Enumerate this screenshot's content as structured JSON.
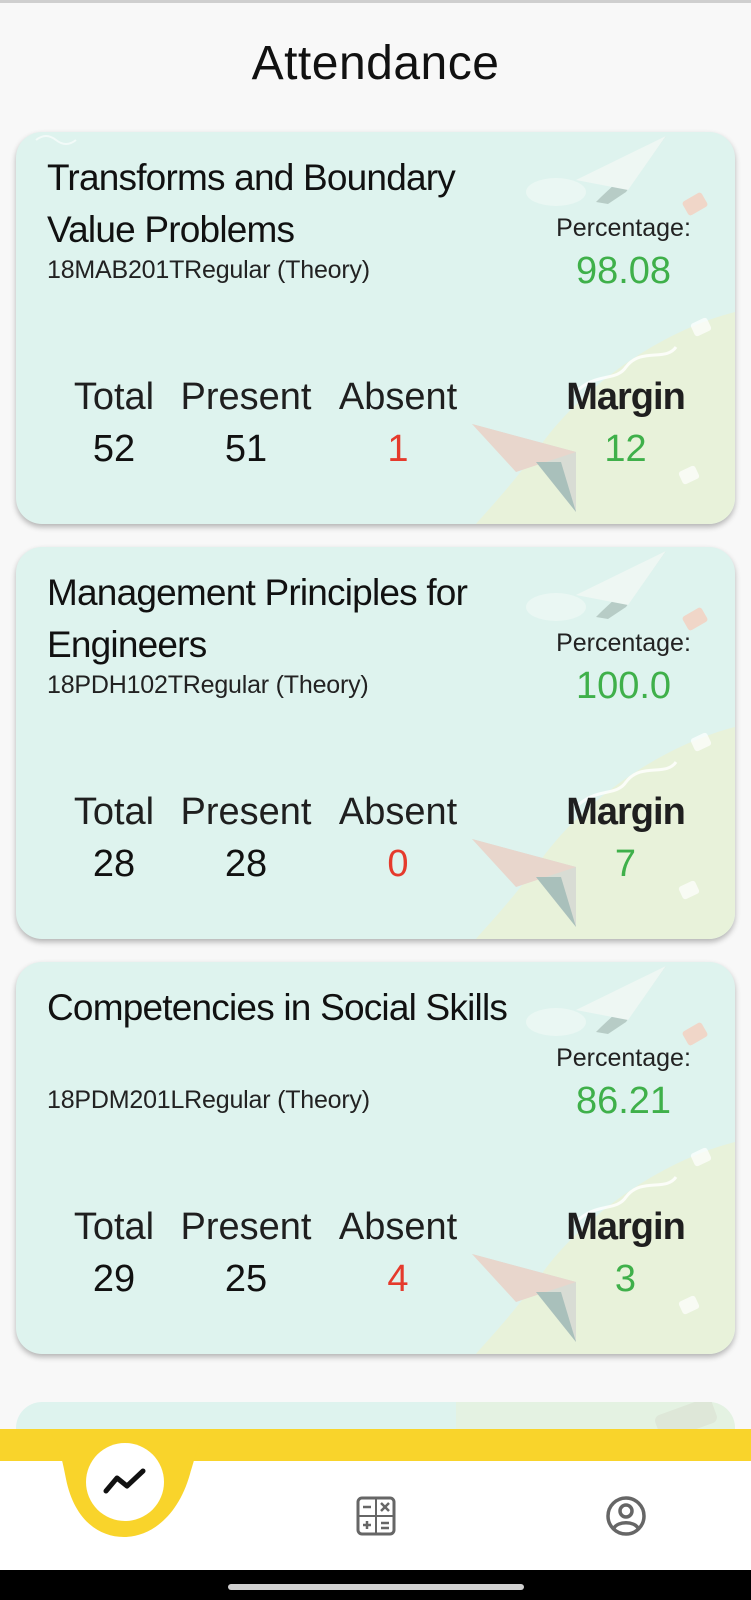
{
  "page": {
    "title": "Attendance"
  },
  "labels": {
    "percentage": "Percentage:",
    "total": "Total",
    "present": "Present",
    "absent": "Absent",
    "margin": "Margin"
  },
  "colors": {
    "card_bg": "#def3ee",
    "positive": "#3fb04a",
    "negative": "#e53a2c",
    "accent_yellow": "#f9d42b"
  },
  "courses": [
    {
      "title": "Transforms and Boundary Value Problems",
      "code": "18MAB201TRegular (Theory)",
      "percentage": "98.08",
      "total": "52",
      "present": "51",
      "absent": "1",
      "margin": "12"
    },
    {
      "title": "Management Principles for Engineers",
      "code": "18PDH102TRegular (Theory)",
      "percentage": "100.0",
      "total": "28",
      "present": "28",
      "absent": "0",
      "margin": "7"
    },
    {
      "title": "Competencies in Social Skills",
      "code": "18PDM201LRegular (Theory)",
      "percentage": "86.21",
      "total": "29",
      "present": "25",
      "absent": "4",
      "margin": "3"
    }
  ],
  "nav": {
    "items": [
      {
        "name": "attendance",
        "icon": "trend-line-icon",
        "active": true
      },
      {
        "name": "marks",
        "icon": "calculator-icon",
        "active": false
      },
      {
        "name": "profile",
        "icon": "user-circle-icon",
        "active": false
      }
    ]
  }
}
